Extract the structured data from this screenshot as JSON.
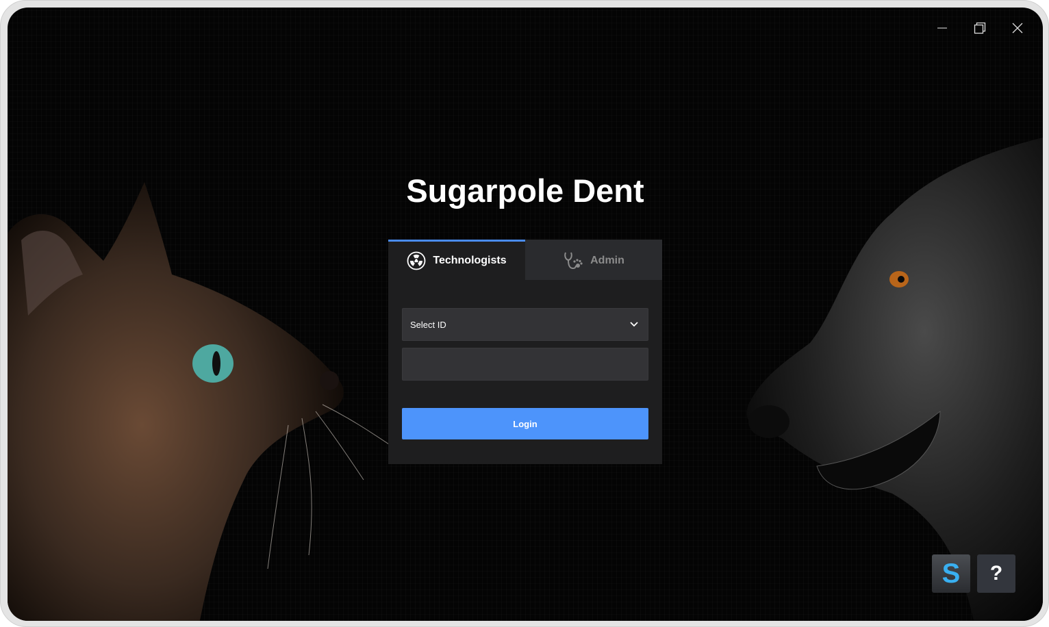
{
  "app": {
    "title": "Sugarpole Dent"
  },
  "window_controls": {
    "minimize_icon": "minimize-icon",
    "restore_icon": "restore-icon",
    "close_icon": "close-icon"
  },
  "login_panel": {
    "tabs": [
      {
        "label": "Technologists",
        "icon": "radiation-icon",
        "active": true
      },
      {
        "label": "Admin",
        "icon": "stethoscope-paw-icon",
        "active": false
      }
    ],
    "id_select": {
      "selected": "Select ID",
      "icon": "chevron-down-icon"
    },
    "password": {
      "value": "",
      "placeholder": ""
    },
    "login_label": "Login"
  },
  "corner_buttons": {
    "s_label": "S",
    "help_label": "?"
  },
  "colors": {
    "accent": "#4d94fb",
    "tab_indicator": "#4a8cf0",
    "s_logo": "#39aff0"
  }
}
